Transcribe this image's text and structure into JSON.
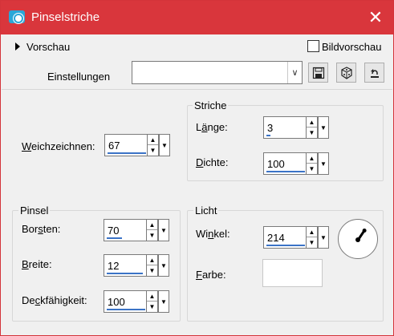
{
  "window": {
    "title": "Pinselstriche",
    "close_label": "✕"
  },
  "preview": {
    "label": "Vorschau",
    "checkbox_label": "Bildvorschau",
    "checked": false
  },
  "settings": {
    "label": "Einstellungen",
    "value": ""
  },
  "icons": {
    "app": "camera-app-icon",
    "save": "save-icon",
    "randomize": "dice-icon",
    "reset": "reset-icon",
    "close": "close-icon",
    "expand": "triangle-right-icon"
  },
  "fields": {
    "weichzeichnen": {
      "label_pre": "",
      "label_u": "W",
      "label_post": "eichzeichnen:",
      "value": "67"
    },
    "striche": {
      "title": "Striche",
      "laenge": {
        "label_pre": "L",
        "label_u": "ä",
        "label_post": "nge:",
        "value": "3"
      },
      "dichte": {
        "label_pre": "",
        "label_u": "D",
        "label_post": "ichte:",
        "value": "100"
      }
    },
    "pinsel": {
      "title": "Pinsel",
      "borsten": {
        "label_pre": "Bor",
        "label_u": "s",
        "label_post": "ten:",
        "value": "70"
      },
      "breite": {
        "label_pre": "",
        "label_u": "B",
        "label_post": "reite:",
        "value": "12"
      },
      "deckfaehigkeit": {
        "label_pre": "De",
        "label_u": "c",
        "label_post": "kfähigkeit:",
        "value": "100"
      }
    },
    "licht": {
      "title": "Licht",
      "winkel": {
        "label_pre": "Wi",
        "label_u": "n",
        "label_post": "kel:",
        "value": "214"
      },
      "farbe": {
        "label_pre": "",
        "label_u": "F",
        "label_post": "arbe:",
        "color": "#ffffff"
      }
    }
  },
  "colors": {
    "titlebar": "#d9363c",
    "accent": "#3b73c6"
  }
}
